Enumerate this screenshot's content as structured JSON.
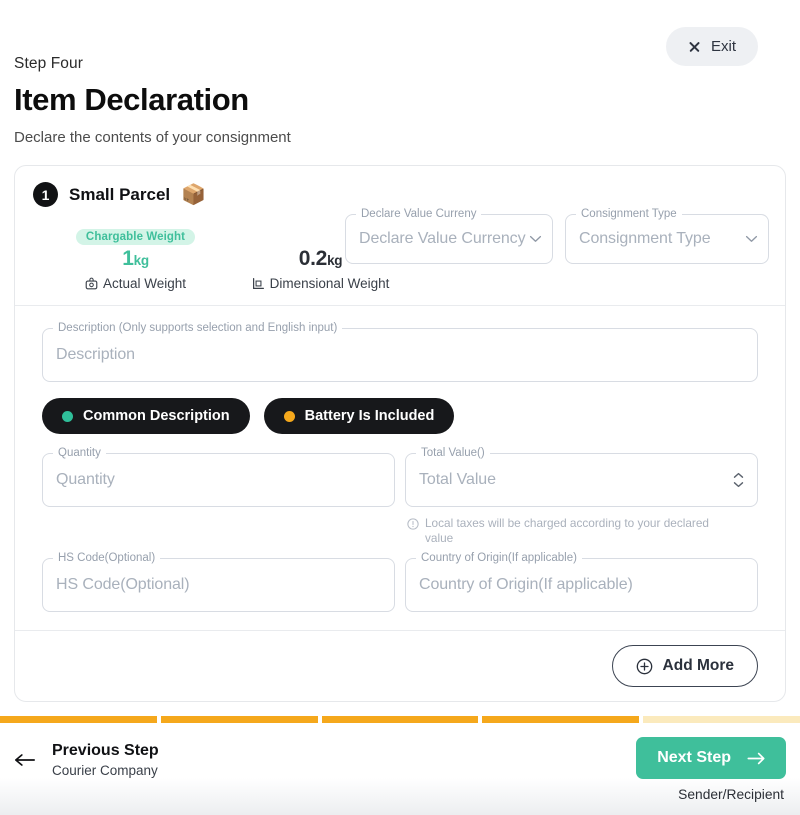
{
  "exit": {
    "label": "Exit",
    "icon": "close-icon"
  },
  "header": {
    "kicker": "Step Four",
    "title": "Item Declaration",
    "subtitle": "Declare the contents of your consignment"
  },
  "parcel": {
    "number": "1",
    "title": "Small Parcel",
    "emoji": "📦",
    "chargable_badge": "Chargable Weight",
    "actual": {
      "value": "1",
      "unit": "kg",
      "label": "Actual Weight",
      "icon": "scale-icon"
    },
    "dimensional": {
      "value": "0.2",
      "unit": "kg",
      "label": "Dimensional Weight",
      "icon": "ruler-box-icon"
    }
  },
  "selects": {
    "currency": {
      "label": "Declare Value Curreny",
      "placeholder": "Declare Value Currency"
    },
    "consignment": {
      "label": "Consignment Type",
      "placeholder": "Consignment Type"
    }
  },
  "form": {
    "description": {
      "label": "Description (Only supports selection and English input)",
      "placeholder": "Description"
    },
    "quantity": {
      "label": "Quantity",
      "placeholder": "Quantity"
    },
    "total_value": {
      "label": "Total Value()",
      "placeholder": "Total Value"
    },
    "total_value_helper": "Local taxes will be charged according to your declared value",
    "hs_code": {
      "label": "HS Code(Optional)",
      "placeholder": "HS Code(Optional)"
    },
    "country_origin": {
      "label": "Country of Origin(If applicable)",
      "placeholder": "Country of Origin(If applicable)"
    }
  },
  "tags": {
    "common_description": {
      "label": "Common Description",
      "dot_color": "#2fbf9a"
    },
    "battery_included": {
      "label": "Battery Is Included",
      "dot_color": "#f5a81c"
    }
  },
  "add_more": {
    "label": "Add More",
    "icon": "plus-circle-icon"
  },
  "progress": {
    "total": 5,
    "completed": 4,
    "fill_color": "#f5a81c",
    "empty_color": "#fbeabd"
  },
  "footer": {
    "previous": {
      "title": "Previous Step",
      "subtitle": "Courier Company"
    },
    "next": {
      "title": "Next Step",
      "subtitle": "Sender/Recipient",
      "color": "#3fbf9b"
    }
  }
}
